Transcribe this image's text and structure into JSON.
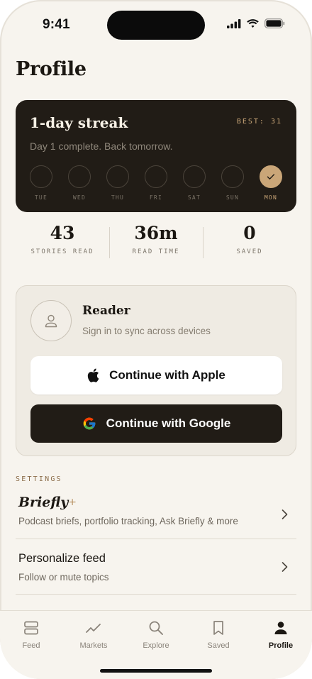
{
  "status_bar": {
    "time": "9:41"
  },
  "page": {
    "title": "Profile"
  },
  "streak": {
    "title": "1-day streak",
    "best": "BEST: 31",
    "subtitle": "Day 1 complete. Back tomorrow.",
    "days": [
      {
        "label": "TUE",
        "done": false
      },
      {
        "label": "WED",
        "done": false
      },
      {
        "label": "THU",
        "done": false
      },
      {
        "label": "FRI",
        "done": false
      },
      {
        "label": "SAT",
        "done": false
      },
      {
        "label": "SUN",
        "done": false
      },
      {
        "label": "MON",
        "done": true
      }
    ]
  },
  "stats": [
    {
      "value": "43",
      "label": "STORIES READ"
    },
    {
      "value": "36m",
      "label": "READ TIME"
    },
    {
      "value": "0",
      "label": "SAVED"
    }
  ],
  "account": {
    "name": "Reader",
    "subtitle": "Sign in to sync across devices",
    "apple_label": "Continue with Apple",
    "google_label": "Continue with Google"
  },
  "settings": {
    "section_label": "SETTINGS",
    "briefly_plus": {
      "title": "Briefly",
      "plus": "+",
      "subtitle": "Podcast briefs, portfolio tracking, Ask Briefly & more"
    },
    "personalize": {
      "title": "Personalize feed",
      "subtitle": "Follow or mute topics"
    }
  },
  "tabs": [
    {
      "label": "Feed",
      "icon": "feed-icon",
      "active": false
    },
    {
      "label": "Markets",
      "icon": "markets-icon",
      "active": false
    },
    {
      "label": "Explore",
      "icon": "search-icon",
      "active": false
    },
    {
      "label": "Saved",
      "icon": "bookmark-icon",
      "active": false
    },
    {
      "label": "Profile",
      "icon": "person-icon",
      "active": true
    }
  ],
  "colors": {
    "background": "#f7f4ee",
    "dark_card": "#211c16",
    "accent_gold": "#caa678"
  }
}
